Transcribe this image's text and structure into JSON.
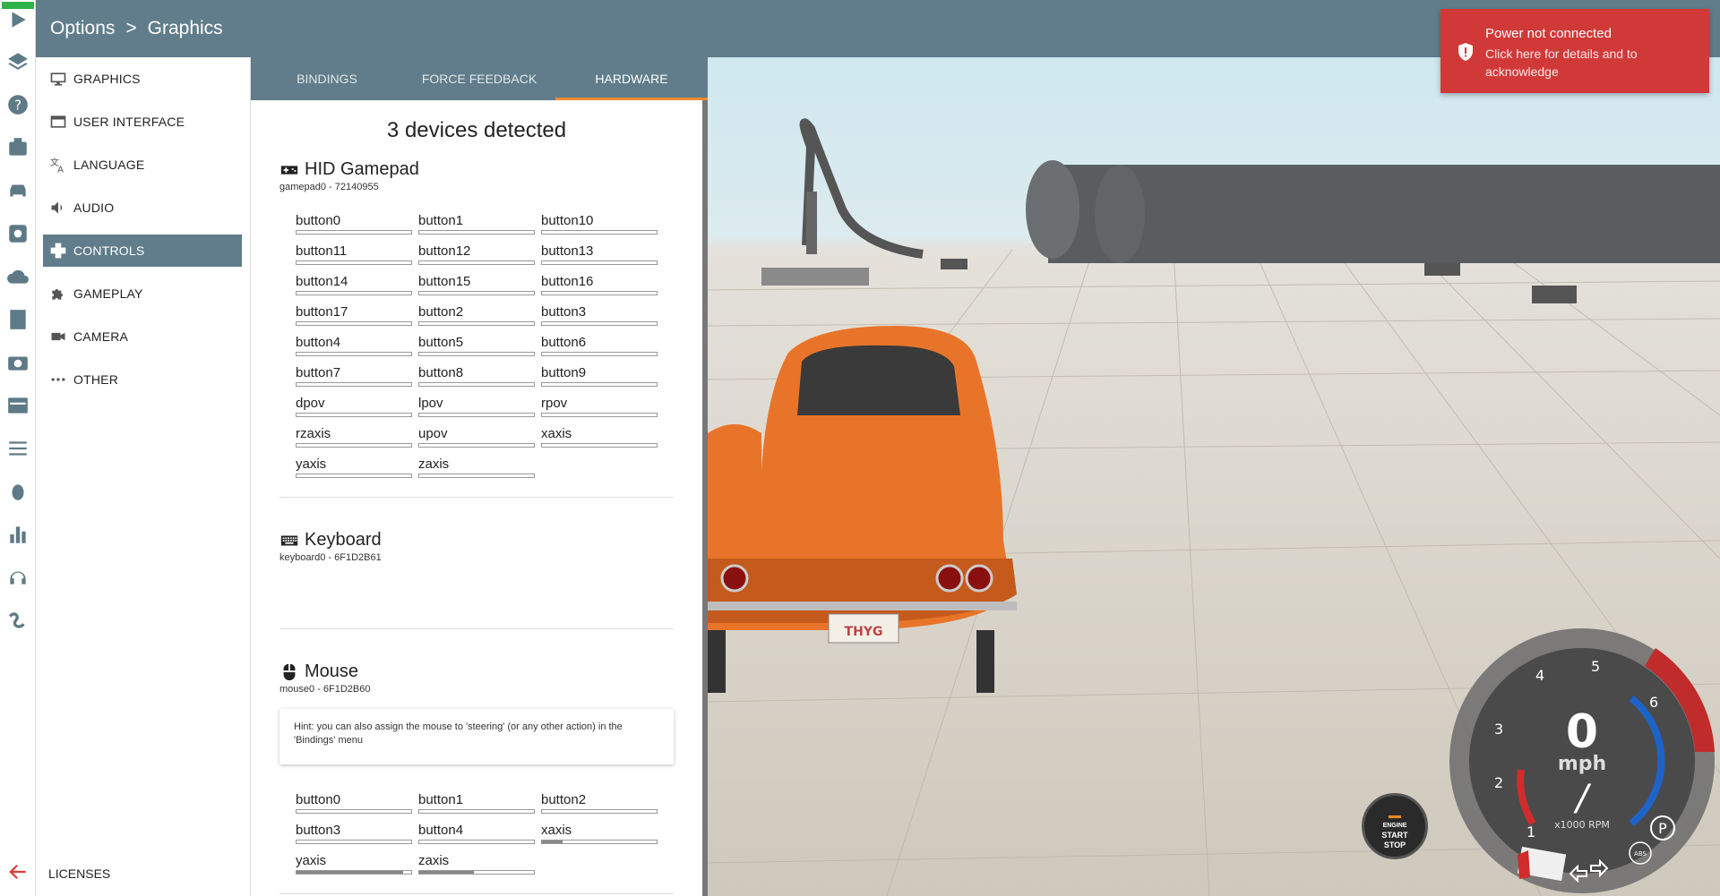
{
  "header": {
    "breadcrumb": [
      "Options",
      ">",
      "Graphics"
    ]
  },
  "menu": {
    "items": [
      {
        "label": "GRAPHICS",
        "icon": "monitor-icon"
      },
      {
        "label": "USER INTERFACE",
        "icon": "window-icon"
      },
      {
        "label": "LANGUAGE",
        "icon": "translate-icon"
      },
      {
        "label": "AUDIO",
        "icon": "speaker-icon"
      },
      {
        "label": "CONTROLS",
        "icon": "gamepad-icon",
        "active": true
      },
      {
        "label": "GAMEPLAY",
        "icon": "puzzle-icon"
      },
      {
        "label": "CAMERA",
        "icon": "videocam-icon"
      },
      {
        "label": "OTHER",
        "icon": "more-icon"
      }
    ],
    "licenses": "LICENSES"
  },
  "tabs": [
    {
      "label": "BINDINGS"
    },
    {
      "label": "FORCE FEEDBACK"
    },
    {
      "label": "HARDWARE",
      "active": true
    }
  ],
  "hardware": {
    "title": "3 devices detected",
    "gamepad": {
      "name": "HID Gamepad",
      "id": "gamepad0 - 72140955",
      "inputs": [
        "button0",
        "button1",
        "button10",
        "button11",
        "button12",
        "button13",
        "button14",
        "button15",
        "button16",
        "button17",
        "button2",
        "button3",
        "button4",
        "button5",
        "button6",
        "button7",
        "button8",
        "button9",
        "dpov",
        "lpov",
        "rpov",
        "rzaxis",
        "upov",
        "xaxis",
        "yaxis",
        "zaxis"
      ]
    },
    "keyboard": {
      "name": "Keyboard",
      "id": "keyboard0 - 6F1D2B61"
    },
    "mouse": {
      "name": "Mouse",
      "id": "mouse0 - 6F1D2B60",
      "hint": "Hint: you can also assign the mouse to 'steering' (or any other action) in the 'Bindings' menu",
      "inputs": [
        {
          "label": "button0",
          "level": 0
        },
        {
          "label": "button1",
          "level": 0
        },
        {
          "label": "button2",
          "level": 0
        },
        {
          "label": "button3",
          "level": 0
        },
        {
          "label": "button4",
          "level": 0
        },
        {
          "label": "xaxis",
          "level": 0.18
        },
        {
          "label": "yaxis",
          "level": 0.93
        },
        {
          "label": "zaxis",
          "level": 0.48
        }
      ]
    }
  },
  "notification": {
    "title": "Power not connected",
    "detail": "Click here for details and to acknowledge",
    "color": "#d13939"
  },
  "gauge": {
    "speed": "0",
    "unit": "mph",
    "rpm_label": "x1000 RPM",
    "gear": "/",
    "ticks": [
      "1",
      "2",
      "3",
      "4",
      "5",
      "6"
    ],
    "abs": "ABS",
    "park": "P"
  },
  "engine": {
    "line1": "ENGINE",
    "line2": "START",
    "line3": "STOP"
  },
  "plate": "THYG",
  "colors": {
    "header": "#617d8b",
    "accent": "#f28b31",
    "car": "#e8742a"
  }
}
